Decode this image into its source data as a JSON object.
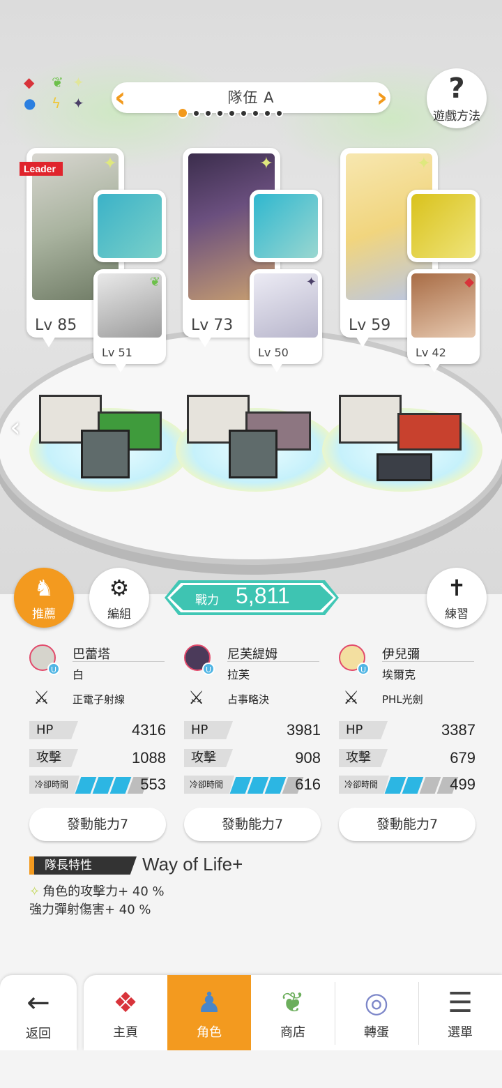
{
  "header": {
    "team_title": "隊伍 A",
    "page_count": 9,
    "active_page": 1,
    "help_label": "遊戲方法",
    "leader_tag": "Leader"
  },
  "characters": [
    {
      "lv_prefix": "Lv",
      "lv": "85",
      "sub_lv": "51",
      "sub_element": "leaf"
    },
    {
      "lv_prefix": "Lv",
      "lv": "73",
      "sub_lv": "50",
      "sub_element": "dark-star"
    },
    {
      "lv_prefix": "Lv",
      "lv": "59",
      "sub_lv": "42",
      "sub_element": "red-diamond"
    }
  ],
  "actions": {
    "recommend_label": "推薦",
    "edit_label": "編組",
    "train_label": "練習"
  },
  "power": {
    "label": "戰力",
    "value": "5,811"
  },
  "units": [
    {
      "name": "巴蕾塔",
      "sub_name": "白",
      "weapon": "正電子射線",
      "hp": "4316",
      "atk": "1088",
      "cd": "553",
      "cd_fill": 0.85,
      "skill": "發動能力7"
    },
    {
      "name": "尼芙緹姆",
      "sub_name": "拉芙",
      "weapon": "占事略決",
      "hp": "3981",
      "atk": "908",
      "cd": "616",
      "cd_fill": 0.85,
      "skill": "發動能力7"
    },
    {
      "name": "伊兒彌",
      "sub_name": "埃爾克",
      "weapon": "PHL光劍",
      "hp": "3387",
      "atk": "679",
      "cd": "499",
      "cd_fill": 0.6,
      "skill": "發動能力7"
    }
  ],
  "stat_labels": {
    "hp": "HP",
    "atk": "攻擊",
    "cd": "冷卻時間"
  },
  "leader_skill": {
    "tag": "隊長特性",
    "name": "Way of Life+",
    "effect1": "角色的攻擊力+ 40 %",
    "effect2": "強力彈射傷害+ 40 %"
  },
  "nav": {
    "back_label": "返回",
    "items": [
      {
        "label": "主頁",
        "icon": "home-icon"
      },
      {
        "label": "角色",
        "icon": "character-icon"
      },
      {
        "label": "商店",
        "icon": "shop-icon"
      },
      {
        "label": "轉蛋",
        "icon": "gacha-icon"
      },
      {
        "label": "選單",
        "icon": "menu-icon"
      }
    ],
    "active_index": 1
  },
  "colors": {
    "accent": "#f39a1f",
    "teal": "#3ec4b2",
    "cooldown": "#2cb6e3"
  }
}
